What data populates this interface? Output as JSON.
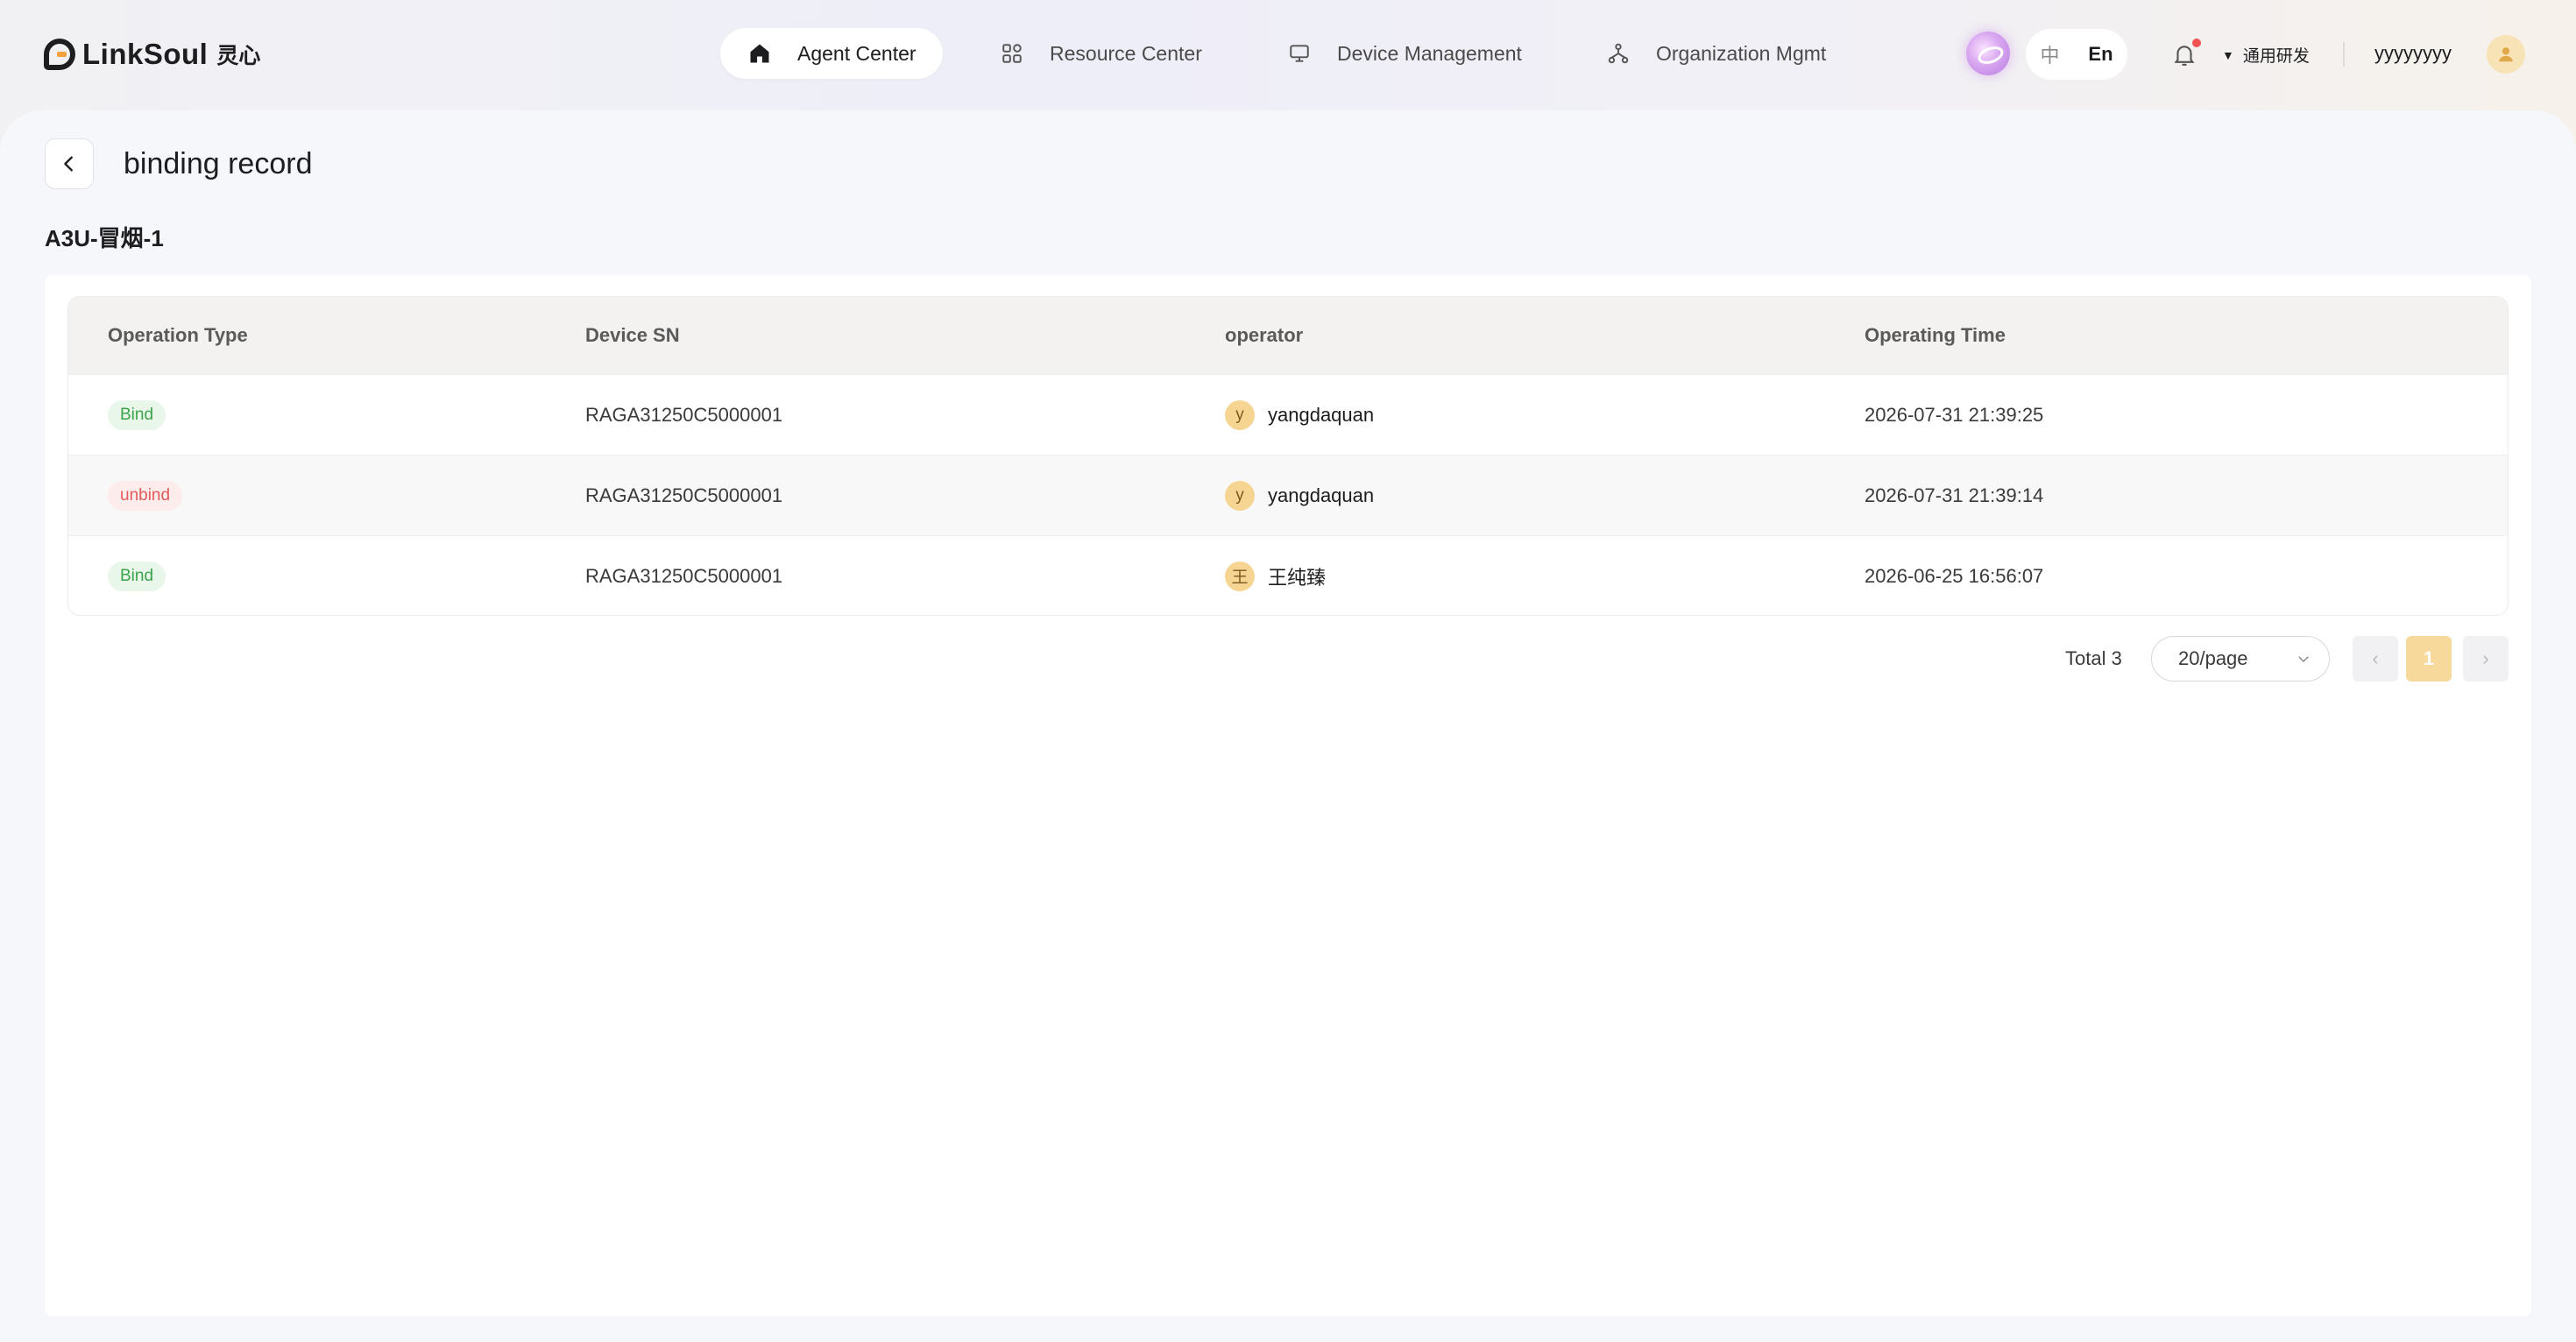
{
  "brand": {
    "name": "LinkSoul",
    "cn_name": "灵心"
  },
  "nav": [
    {
      "label": "Agent Center",
      "icon": "home-icon",
      "active": true
    },
    {
      "label": "Resource Center",
      "icon": "grid-icon",
      "active": false
    },
    {
      "label": "Device Management",
      "icon": "monitor-icon",
      "active": false
    },
    {
      "label": "Organization Mgmt",
      "icon": "org-tree-icon",
      "active": false
    }
  ],
  "header": {
    "lang_zh": "中",
    "lang_en": "En",
    "org_name": "通用研发",
    "username": "yyyyyyyy",
    "notification_dot_color": "#f05252"
  },
  "page": {
    "title": "binding record",
    "device_name": "A3U-冒烟-1"
  },
  "table": {
    "columns": [
      "Operation Type",
      "Device SN",
      "operator",
      "Operating Time"
    ],
    "rows": [
      {
        "type": "Bind",
        "type_status": "bind",
        "sn": "RAGA31250C5000001",
        "operator_initial": "y",
        "operator": "yangdaquan",
        "time": "2026-07-31 21:39:25"
      },
      {
        "type": "unbind",
        "type_status": "unbind",
        "sn": "RAGA31250C5000001",
        "operator_initial": "y",
        "operator": "yangdaquan",
        "time": "2026-07-31 21:39:14"
      },
      {
        "type": "Bind",
        "type_status": "bind",
        "sn": "RAGA31250C5000001",
        "operator_initial": "王",
        "operator": "王纯臻",
        "time": "2026-06-25 16:56:07"
      }
    ]
  },
  "pagination": {
    "total_label": "Total 3",
    "page_size": "20/page",
    "current_page": "1",
    "prev": "‹",
    "next": "›"
  },
  "colors": {
    "accent": "#f8d99c",
    "bind_tag": "#3ba34a",
    "unbind_tag": "#e55a5a"
  }
}
